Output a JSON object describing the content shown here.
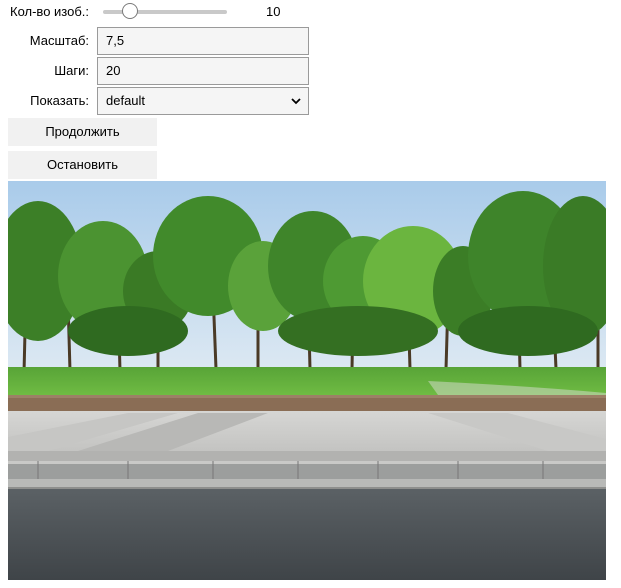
{
  "controls": {
    "count": {
      "label": "Кол-во изоб.:",
      "value": "10",
      "level_fraction": 0.1
    },
    "scale": {
      "label": "Масштаб:",
      "value": "7,5"
    },
    "steps": {
      "label": "Шаги:",
      "value": "20"
    },
    "show": {
      "label": "Показать:",
      "selected": "default"
    }
  },
  "buttons": {
    "continue": "Продолжить",
    "stop": "Остановить"
  },
  "image": {
    "subject": "park-with-trees-and-sidewalk",
    "colors": {
      "sky": "#b9d6ee",
      "foliage": "#3f8a2a",
      "grass": "#64b43a",
      "pavement": "#c9c9c9",
      "asphalt": "#4d5358"
    }
  }
}
